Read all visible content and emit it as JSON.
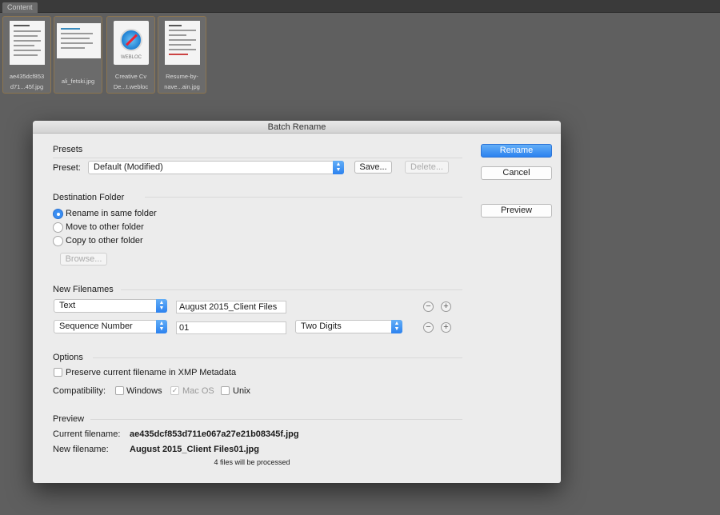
{
  "panel": {
    "tab": "Content"
  },
  "thumbnails": [
    {
      "line1": "ae435dcf853",
      "line2": "d71...45f.jpg"
    },
    {
      "line1": "ali_fetski.jpg",
      "line2": ""
    },
    {
      "line1": "Creative Cv",
      "line2": "De...t.webloc",
      "badge": "WEBLOC"
    },
    {
      "line1": "Resume-by-",
      "line2": "nave...ain.jpg"
    }
  ],
  "dialog": {
    "title": "Batch Rename",
    "buttons": {
      "rename": "Rename",
      "cancel": "Cancel",
      "preview": "Preview"
    },
    "presets": {
      "section": "Presets",
      "label": "Preset:",
      "value": "Default (Modified)",
      "save": "Save...",
      "delete": "Delete..."
    },
    "destination": {
      "section": "Destination Folder",
      "options": [
        "Rename in same folder",
        "Move to other folder",
        "Copy to other folder"
      ],
      "selected_index": 0,
      "browse": "Browse..."
    },
    "new_filenames": {
      "section": "New Filenames",
      "rows": [
        {
          "type": "Text",
          "value": "August 2015_Client Files"
        },
        {
          "type": "Sequence Number",
          "value": "01",
          "digits": "Two Digits"
        }
      ]
    },
    "options": {
      "section": "Options",
      "preserve": "Preserve current filename in XMP Metadata",
      "preserve_checked": false,
      "compat_label": "Compatibility:",
      "compat": [
        {
          "label": "Windows",
          "checked": false,
          "disabled": false
        },
        {
          "label": "Mac OS",
          "checked": true,
          "disabled": true
        },
        {
          "label": "Unix",
          "checked": false,
          "disabled": false
        }
      ]
    },
    "preview": {
      "section": "Preview",
      "current_label": "Current filename:",
      "current_value": "ae435dcf853d711e067a27e21b08345f.jpg",
      "new_label": "New filename:",
      "new_value": "August 2015_Client Files01.jpg",
      "summary": "4 files will be processed"
    }
  },
  "colors": {
    "accent": "#2c82ef",
    "background": "#5f5f5f",
    "dialog": "#ececec"
  }
}
